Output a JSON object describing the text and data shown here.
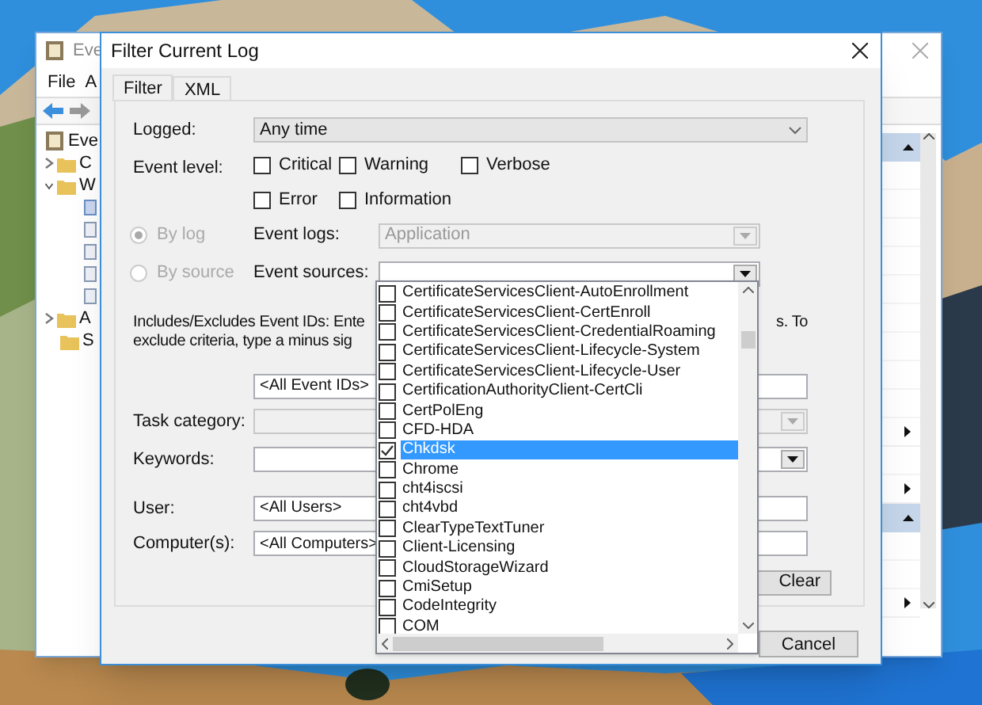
{
  "background_window": {
    "title": "Eve",
    "menu": [
      "File",
      "A"
    ],
    "tree": [
      {
        "label": "Eve",
        "kind": "root",
        "children": [
          {
            "label": "C",
            "kind": "collapsed"
          },
          {
            "label": "W",
            "kind": "expanded",
            "children": [
              {
                "kind": "log",
                "selected": true
              },
              {
                "kind": "log",
                "selected": false
              },
              {
                "kind": "log",
                "selected": false
              },
              {
                "kind": "log",
                "selected": false
              },
              {
                "kind": "log",
                "selected": false
              }
            ]
          },
          {
            "label": "A",
            "kind": "collapsed"
          },
          {
            "label": "S",
            "kind": "leaf"
          }
        ]
      }
    ],
    "action_rows": [
      {
        "kind": "header"
      },
      {
        "kind": "blank"
      },
      {
        "kind": "blank"
      },
      {
        "kind": "blank"
      },
      {
        "kind": "blank"
      },
      {
        "kind": "blank"
      },
      {
        "kind": "blank"
      },
      {
        "kind": "blank"
      },
      {
        "kind": "blank"
      },
      {
        "kind": "blank"
      },
      {
        "kind": "submenu"
      },
      {
        "kind": "blank"
      },
      {
        "kind": "submenu"
      },
      {
        "kind": "header"
      },
      {
        "kind": "blank"
      },
      {
        "kind": "blank"
      },
      {
        "kind": "submenu"
      }
    ]
  },
  "dialog": {
    "title": "Filter Current Log",
    "tabs": [
      {
        "label": "Filter",
        "selected": true
      },
      {
        "label": "XML",
        "selected": false
      }
    ],
    "logged": {
      "label": "Logged:",
      "value": "Any time"
    },
    "event_level": {
      "label": "Event level:",
      "options": [
        {
          "label": "Critical",
          "checked": false
        },
        {
          "label": "Warning",
          "checked": false
        },
        {
          "label": "Verbose",
          "checked": false
        },
        {
          "label": "Error",
          "checked": false
        },
        {
          "label": "Information",
          "checked": false
        }
      ]
    },
    "source_modes": [
      {
        "label": "By log",
        "selected": true,
        "field_label": "Event logs:",
        "value": "Application",
        "disabled": true
      },
      {
        "label": "By source",
        "selected": false,
        "field_label": "Event sources:",
        "disabled": false
      }
    ],
    "ids_help": {
      "line_1_left": "Includes/Excludes Event IDs: Ente",
      "line_1_right": "s. To",
      "line_2": "exclude criteria, type a minus sig"
    },
    "event_ids": {
      "value": "<All Event IDs>"
    },
    "task_category": {
      "label": "Task category:"
    },
    "keywords": {
      "label": "Keywords:"
    },
    "user": {
      "label": "User:",
      "value": "<All Users>"
    },
    "computers": {
      "label": "Computer(s):",
      "value": "<All Computers>"
    },
    "clear_button": "Clear",
    "cancel_button": "Cancel",
    "sources_list": [
      {
        "label": "CertificateServicesClient-AutoEnrollment",
        "checked": false,
        "selected": false
      },
      {
        "label": "CertificateServicesClient-CertEnroll",
        "checked": false,
        "selected": false
      },
      {
        "label": "CertificateServicesClient-CredentialRoaming",
        "checked": false,
        "selected": false
      },
      {
        "label": "CertificateServicesClient-Lifecycle-System",
        "checked": false,
        "selected": false
      },
      {
        "label": "CertificateServicesClient-Lifecycle-User",
        "checked": false,
        "selected": false
      },
      {
        "label": "CertificationAuthorityClient-CertCli",
        "checked": false,
        "selected": false
      },
      {
        "label": "CertPolEng",
        "checked": false,
        "selected": false
      },
      {
        "label": "CFD-HDA",
        "checked": false,
        "selected": false
      },
      {
        "label": "Chkdsk",
        "checked": true,
        "selected": true
      },
      {
        "label": "Chrome",
        "checked": false,
        "selected": false
      },
      {
        "label": "cht4iscsi",
        "checked": false,
        "selected": false
      },
      {
        "label": "cht4vbd",
        "checked": false,
        "selected": false
      },
      {
        "label": "ClearTypeTextTuner",
        "checked": false,
        "selected": false
      },
      {
        "label": "Client-Licensing",
        "checked": false,
        "selected": false
      },
      {
        "label": "CloudStorageWizard",
        "checked": false,
        "selected": false
      },
      {
        "label": "CmiSetup",
        "checked": false,
        "selected": false
      },
      {
        "label": "CodeIntegrity",
        "checked": false,
        "selected": false
      },
      {
        "label": "COM",
        "checked": false,
        "selected": false
      }
    ]
  }
}
